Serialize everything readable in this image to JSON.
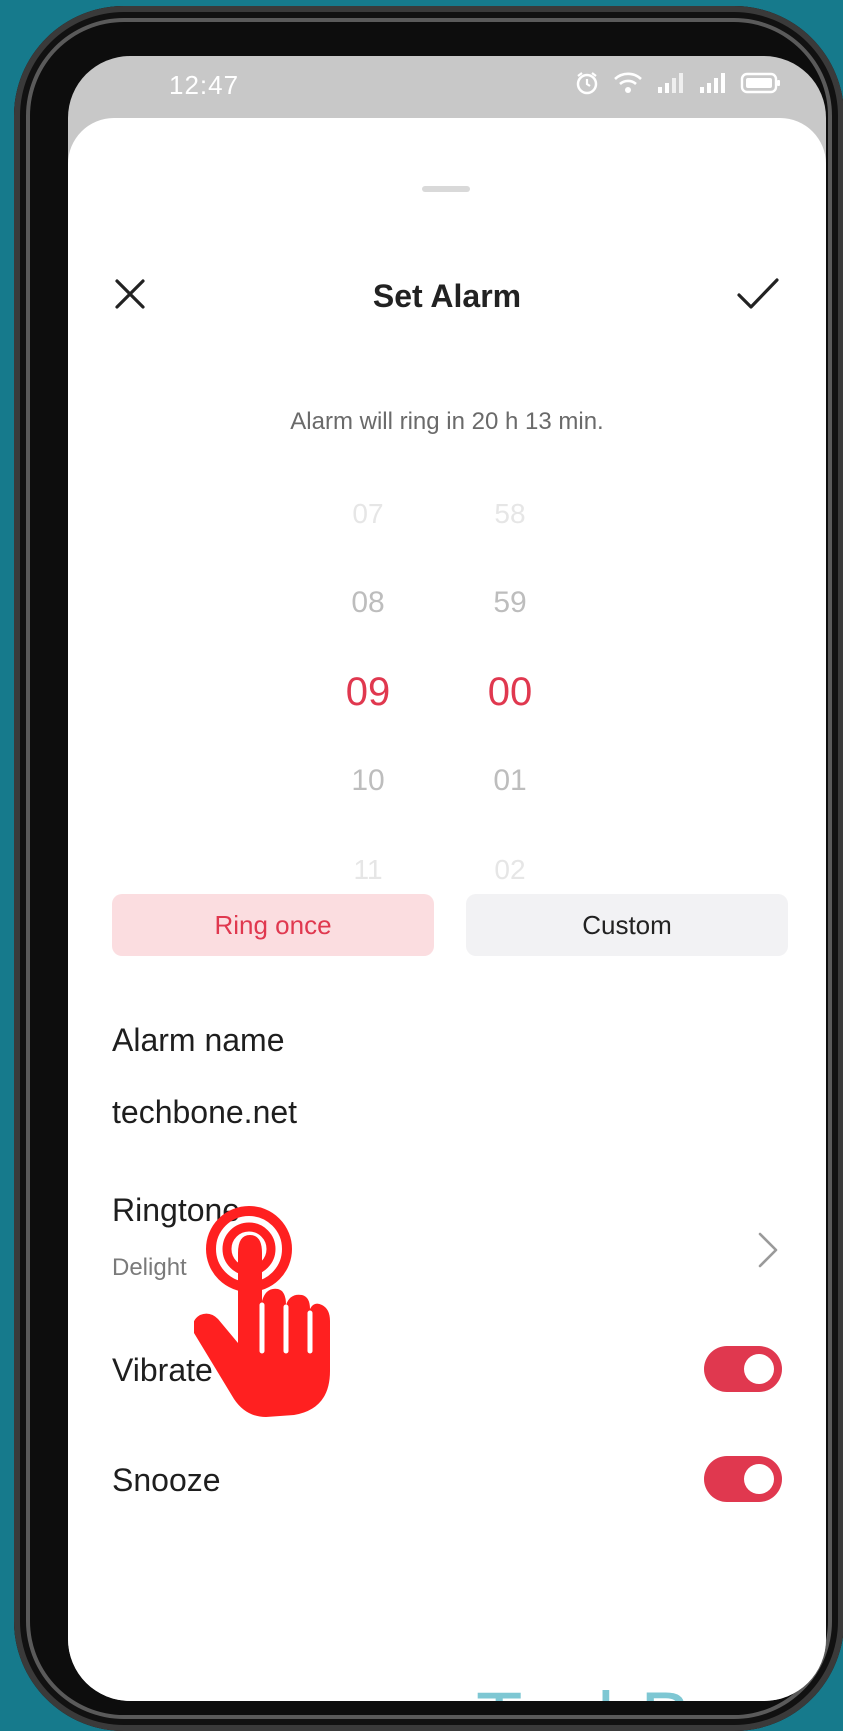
{
  "status_bar": {
    "time": "12:47",
    "icons": [
      "alarm-icon",
      "wifi-icon",
      "signal-icon",
      "signal-icon",
      "battery-icon"
    ]
  },
  "header": {
    "title": "Set Alarm",
    "close_icon": "close-icon",
    "confirm_icon": "check-icon"
  },
  "countdown_text": "Alarm will ring in 20 h 13 min.",
  "time_picker": {
    "hours": [
      "07",
      "08",
      "09",
      "10",
      "11"
    ],
    "minutes": [
      "58",
      "59",
      "00",
      "01",
      "02"
    ],
    "selected_hour": "09",
    "selected_minute": "00"
  },
  "repeat": {
    "options": [
      "Ring once",
      "Custom"
    ],
    "selected": "Ring once"
  },
  "alarm_name": {
    "label": "Alarm name",
    "value": "techbone.net"
  },
  "ringtone": {
    "label": "Ringtone",
    "value": "Delight"
  },
  "vibrate": {
    "label": "Vibrate",
    "on": true
  },
  "snooze": {
    "label": "Snooze",
    "on": true
  },
  "colors": {
    "accent": "#e0384f",
    "accent_light": "#fbdde0",
    "background": "#167a8c"
  },
  "watermark": "TechBone"
}
